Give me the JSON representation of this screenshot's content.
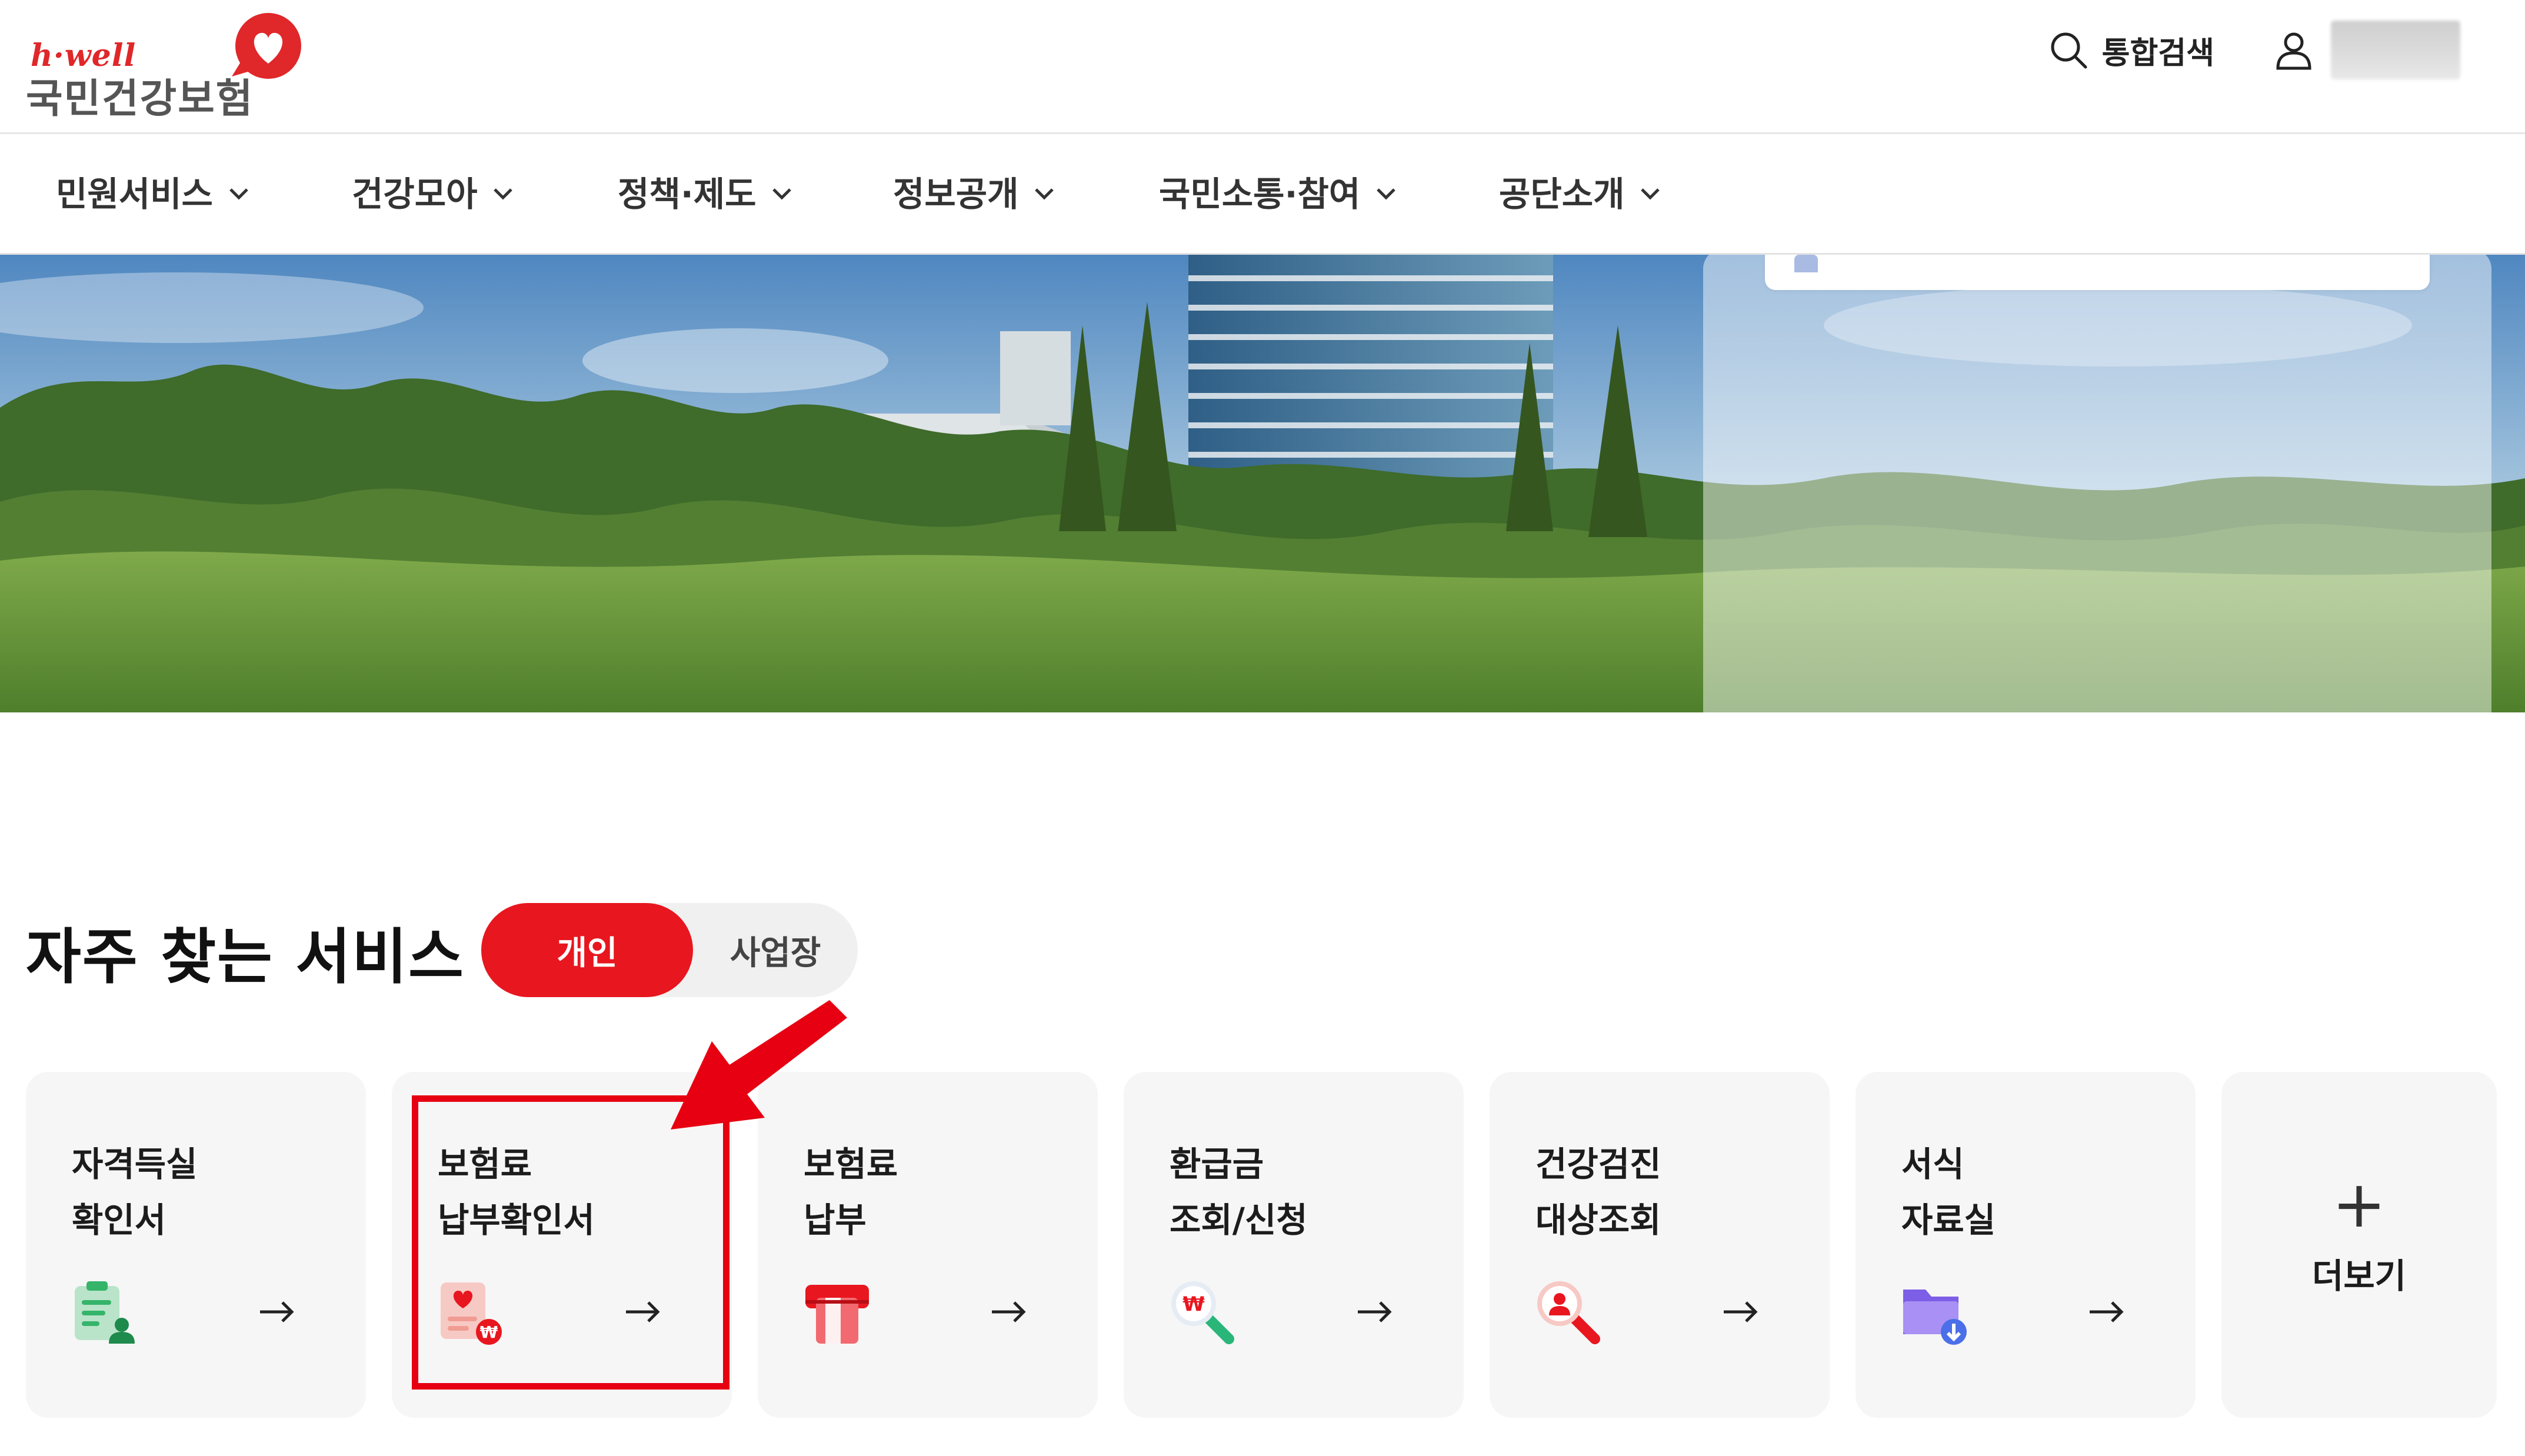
{
  "brand": {
    "tagline": "h·well",
    "name": "국민건강보험",
    "color": "#e0272a"
  },
  "utility": {
    "search_label": "통합검색",
    "search_icon": "search-icon",
    "user_icon": "user-icon"
  },
  "gnb": {
    "items": [
      {
        "label": "민원서비스"
      },
      {
        "label": "건강모아"
      },
      {
        "label": "정책·제도"
      },
      {
        "label": "정보공개"
      },
      {
        "label": "국민소통·참여"
      },
      {
        "label": "공단소개"
      }
    ]
  },
  "frequent": {
    "title": "자주 찾는 서비스",
    "toggle": {
      "personal": "개인",
      "business": "사업장"
    },
    "accent_color": "#e8161f",
    "cards": [
      {
        "title": "자격득실\n확인서",
        "icon": "document-person-icon",
        "arrow": "→"
      },
      {
        "title": "보험료\n납부확인서",
        "icon": "receipt-won-icon",
        "arrow": "→"
      },
      {
        "title": "보험료\n납부",
        "icon": "card-payment-icon",
        "arrow": "→"
      },
      {
        "title": "환급금\n조회/신청",
        "icon": "won-search-icon",
        "arrow": "→"
      },
      {
        "title": "건강검진\n대상조회",
        "icon": "person-search-icon",
        "arrow": "→"
      },
      {
        "title": "서식\n자료실",
        "icon": "folder-download-icon",
        "arrow": "→"
      }
    ],
    "more": {
      "plus": "+",
      "label": "더보기"
    }
  }
}
